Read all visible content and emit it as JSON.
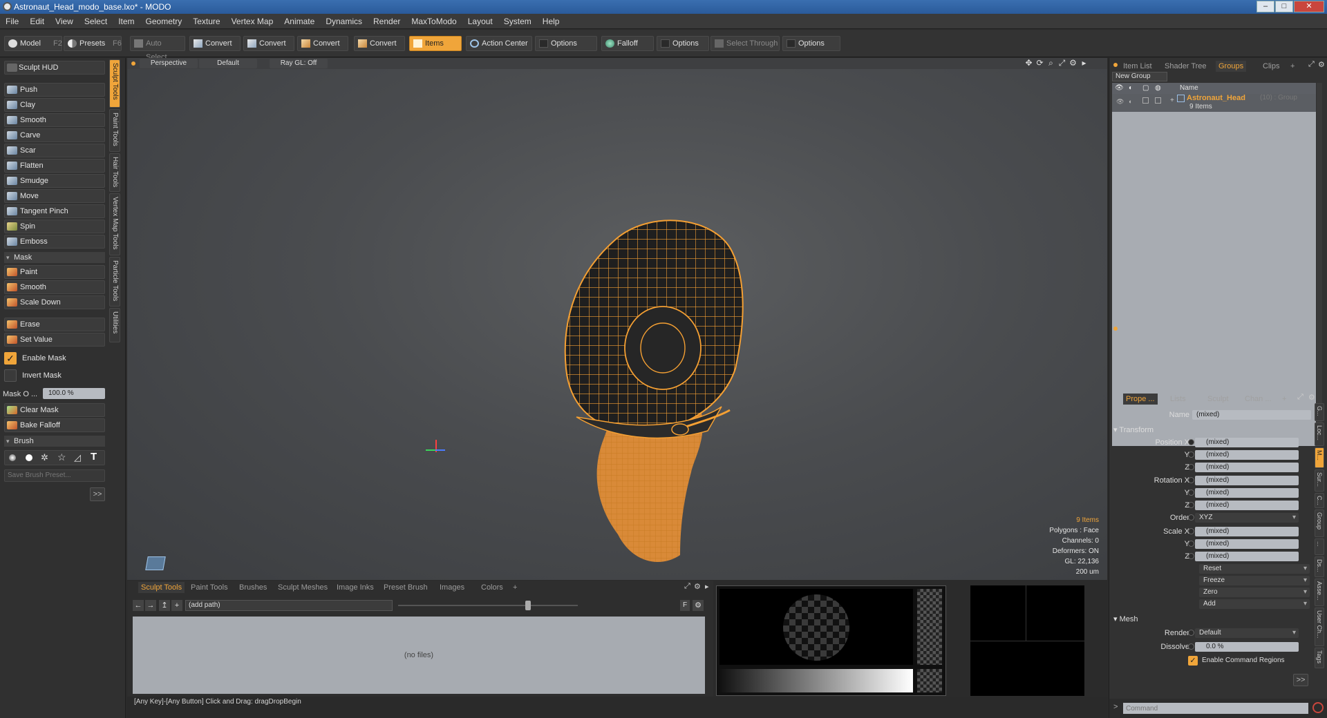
{
  "window": {
    "title": "Astronaut_Head_modo_base.lxo* - MODO",
    "buttons": [
      "–",
      "□",
      "✕"
    ]
  },
  "menubar": [
    "File",
    "Edit",
    "View",
    "Select",
    "Item",
    "Geometry",
    "Texture",
    "Vertex Map",
    "Animate",
    "Dynamics",
    "Render",
    "MaxToModo",
    "Layout",
    "System",
    "Help"
  ],
  "toolbar": {
    "model": "Model",
    "model_key": "F2",
    "presets": "Presets",
    "presets_key": "F6",
    "auto_select": "Auto Select",
    "convert1": "Convert",
    "convert2": "Convert",
    "convert3": "Convert",
    "convert4": "Convert",
    "items": "Items",
    "action_center": "Action Center",
    "options1": "Options",
    "falloff": "Falloff",
    "options2": "Options",
    "select_through": "Select Through",
    "options3": "Options"
  },
  "left": {
    "hud": "Sculpt HUD",
    "tools": [
      "Push",
      "Clay",
      "Smooth",
      "Carve",
      "Scar",
      "Flatten",
      "Smudge",
      "Move",
      "Tangent Pinch",
      "Spin",
      "Emboss"
    ],
    "mask_header": "Mask",
    "mask_tools": [
      "Paint",
      "Smooth",
      "Scale Down"
    ],
    "erase": "Erase",
    "set_value": "Set Value",
    "enable_mask": "Enable Mask",
    "invert_mask": "Invert Mask",
    "mask_opacity_label": "Mask O ...",
    "mask_opacity_value": "100.0 %",
    "clear_mask": "Clear Mask",
    "bake_falloff": "Bake Falloff",
    "brush_header": "Brush",
    "save_brush": "Save Brush Preset...",
    "more": ">>",
    "vtabs": [
      "Sculpt Tools",
      "Paint Tools",
      "Hair Tools",
      "Vertex Map Tools",
      "Particle Tools",
      "Utilities"
    ]
  },
  "viewport": {
    "view": "Perspective",
    "shading": "Default",
    "raygl": "Ray GL: Off",
    "info": {
      "items": "9 Items",
      "polygons": "Polygons : Face",
      "channels": "Channels: 0",
      "deformers": "Deformers: ON",
      "gl": "GL: 22,136",
      "scale": "200 um"
    }
  },
  "bottom": {
    "tabs": [
      "Sculpt Tools",
      "Paint Tools",
      "Brushes",
      "Sculpt Meshes",
      "Image Inks",
      "Preset Brush",
      "Images",
      "Colors",
      "+"
    ],
    "path": "(add path)",
    "no_files": "(no files)",
    "f_button": "F"
  },
  "status": "[Any Key]-[Any Button] Click and Drag:  dragDropBegin",
  "right": {
    "top_tabs": [
      "Item List",
      "Shader Tree",
      "Groups",
      "Clips",
      "+"
    ],
    "new_group": "New Group",
    "name_col": "Name",
    "group_name": "Astronaut_Head",
    "group_meta": "(10) : Group",
    "group_count": "9 Items",
    "prop_tabs": [
      "Prope ...",
      "Lists",
      "Sculpt",
      "Chan ...",
      "+"
    ],
    "name_label": "Name",
    "name_value": "(mixed)",
    "transform": "Transform",
    "position_x": "Position X",
    "rotation_x": "Rotation X",
    "scale_x": "Scale X",
    "y": "Y",
    "z": "Z",
    "mixed": "(mixed)",
    "order_label": "Order",
    "order_value": "XYZ",
    "reset": "Reset",
    "freeze": "Freeze",
    "zero": "Zero",
    "add": "Add",
    "mesh": "Mesh",
    "render_label": "Render",
    "render_value": "Default",
    "dissolve_label": "Dissolve",
    "dissolve_value": "0.0 %",
    "enable_cmd_regions": "Enable Command Regions",
    "more": ">>",
    "command_placeholder": "Command",
    "side_tabs": [
      "G...",
      "Loc...",
      "M...",
      "Sur...",
      "C...",
      "Group",
      "...",
      "Ds...",
      "Asse...",
      "User Ch...",
      "Tags"
    ]
  },
  "colors": {
    "accent": "#f0a53a",
    "wireframe": "#f5a033",
    "viewport_bg": "#4a4c4f",
    "panel_bg": "#303030"
  }
}
